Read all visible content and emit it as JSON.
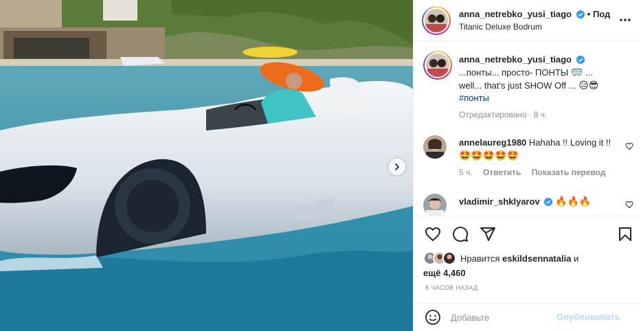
{
  "post": {
    "username": "anna_netrebko_yusi_tiago",
    "follow_partial": "• Под",
    "location": "Titanic Deluxe Bodrum",
    "colors": {
      "verified": "#3897f0",
      "link": "#00376b",
      "muted": "#8e8e8e",
      "publish_disabled": "#b3dbff"
    }
  },
  "caption": {
    "username": "anna_netrebko_yusi_tiago",
    "line1": "...понты... просто- ПОНТЫ",
    "line1_tail": " ...",
    "line2": "well... that's just SHOW Off ...",
    "line2_emojis": "😥😎",
    "hashtag": "#понты",
    "edited": "Отредактировано",
    "age": "8 ч."
  },
  "comments": [
    {
      "username": "annelaureg1980",
      "text": "Hahaha !! Loving it !!",
      "emojis": "🤩🤩🤩🤩🤩",
      "age": "5 ч.",
      "reply": "Ответить",
      "translate": "Показать перевод"
    },
    {
      "username": "vladimir_shklyarov",
      "text": "",
      "emojis": "🔥🔥🔥"
    }
  ],
  "actions": {
    "like_icon": "heart-icon",
    "comment_icon": "comment-icon",
    "share_icon": "share-icon",
    "save_icon": "bookmark-icon"
  },
  "likes": {
    "prefix": "Нравится",
    "user": "eskildsennatalia",
    "mid": "и",
    "count_prefix": "ещё",
    "count": "4,460"
  },
  "timestamp": "8 ЧАСОВ НАЗАД",
  "add_comment": {
    "placeholder": "Добавьте",
    "publish": "Опубликовать"
  }
}
